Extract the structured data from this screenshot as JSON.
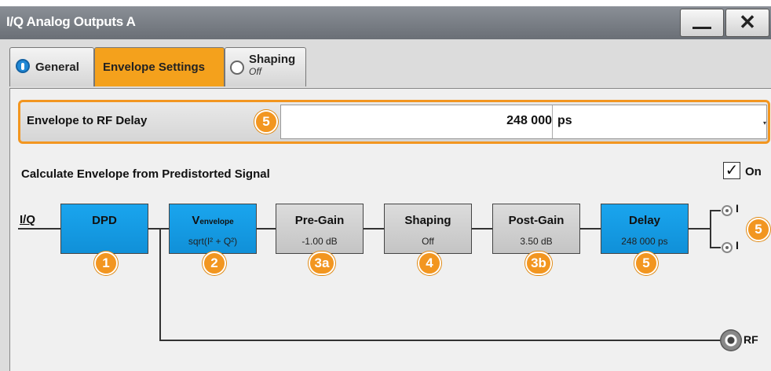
{
  "window": {
    "title": "I/Q Analog Outputs A",
    "minimize_label": "",
    "close_label": "✕"
  },
  "tabs": [
    {
      "label": "General"
    },
    {
      "label": "Envelope Settings"
    },
    {
      "label": "Shaping",
      "sublabel": "Off"
    }
  ],
  "delay": {
    "label": "Envelope to RF Delay",
    "value": "248 000",
    "unit": "ps",
    "badge": "5"
  },
  "calc": {
    "label": "Calculate Envelope from Predistorted Signal",
    "checked": true,
    "check_mark": "✓",
    "on_label": "On"
  },
  "diagram": {
    "input_label": "I/Q",
    "blocks": [
      {
        "title": "DPD",
        "sub": "",
        "badge": "1"
      },
      {
        "title_main": "V",
        "title_sub": "envelope",
        "sub": "sqrt(I² + Q²)",
        "badge": "2"
      },
      {
        "title": "Pre-Gain",
        "sub": "-1.00 dB",
        "badge": "3a"
      },
      {
        "title": "Shaping",
        "sub": "Off",
        "badge": "4"
      },
      {
        "title": "Post-Gain",
        "sub": "3.50 dB",
        "badge": "3b"
      },
      {
        "title": "Delay",
        "sub": "248 000 ps",
        "badge": "5"
      }
    ],
    "outputs": {
      "top_label": "I",
      "bottom_label": "I",
      "badge": "5",
      "rf_label": "RF"
    }
  },
  "colors": {
    "accent": "#f29620",
    "block_active": "#1aa5ee",
    "block_inactive": "#cfcfcf"
  },
  "icons": {
    "general_tab": "radio-selected-icon",
    "shaping_tab": "radio-unselected-icon"
  }
}
